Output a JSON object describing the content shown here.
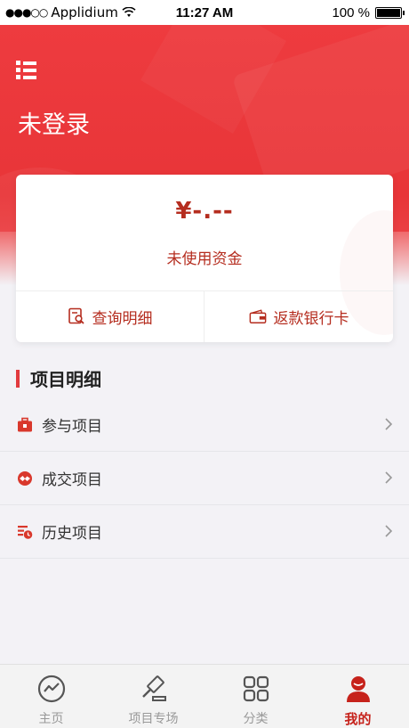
{
  "status_bar": {
    "carrier": "Applidium",
    "time": "11:27 AM",
    "battery": "100 %"
  },
  "header": {
    "title": "未登录",
    "menu_icon": "menu-icon"
  },
  "account_card": {
    "amount": "¥-.--",
    "amount_label": "未使用资金",
    "actions": [
      {
        "label": "查询明细",
        "icon": "search-detail-icon"
      },
      {
        "label": "返款银行卡",
        "icon": "bank-card-icon"
      }
    ]
  },
  "section": {
    "title": "项目明细",
    "items": [
      {
        "label": "参与项目",
        "icon": "briefcase-icon"
      },
      {
        "label": "成交项目",
        "icon": "deal-icon"
      },
      {
        "label": "历史项目",
        "icon": "history-icon"
      }
    ]
  },
  "tabbar": {
    "tabs": [
      {
        "label": "主页",
        "icon": "trend-icon",
        "active": false
      },
      {
        "label": "项目专场",
        "icon": "gavel-icon",
        "active": false
      },
      {
        "label": "分类",
        "icon": "grid-icon",
        "active": false
      },
      {
        "label": "我的",
        "icon": "user-icon",
        "active": true
      }
    ]
  },
  "colors": {
    "brand_red": "#e83538",
    "accent_dark_red": "#b52d1f",
    "tab_active": "#c6221b"
  }
}
